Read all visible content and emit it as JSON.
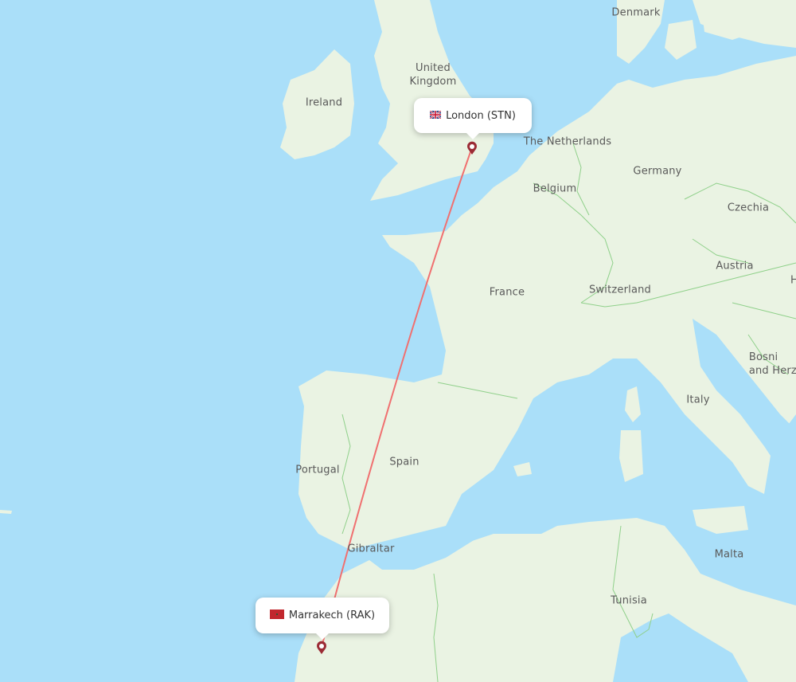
{
  "map": {
    "water_color": "#aadff9",
    "land_color": "#eaf3e3",
    "border_color": "#8fd08a",
    "route_color": "#f07070",
    "marker_color": "#9b2b35"
  },
  "origin": {
    "name": "London (STN)",
    "flag": "uk-flag-icon"
  },
  "destination": {
    "name": "Marrakech (RAK)",
    "flag": "morocco-flag-icon"
  },
  "country_labels": [
    {
      "id": "denmark",
      "text": "Denmark"
    },
    {
      "id": "united-kingdom",
      "text": "United\nKingdom"
    },
    {
      "id": "ireland",
      "text": "Ireland"
    },
    {
      "id": "netherlands",
      "text": "The Netherlands"
    },
    {
      "id": "germany",
      "text": "Germany"
    },
    {
      "id": "belgium",
      "text": "Belgium"
    },
    {
      "id": "czechia",
      "text": "Czechia"
    },
    {
      "id": "austria",
      "text": "Austria"
    },
    {
      "id": "hungary",
      "text": "H"
    },
    {
      "id": "switzerland",
      "text": "Switzerland"
    },
    {
      "id": "france",
      "text": "France"
    },
    {
      "id": "bosnia",
      "text": "Bosni\nand Herze"
    },
    {
      "id": "italy",
      "text": "Italy"
    },
    {
      "id": "spain",
      "text": "Spain"
    },
    {
      "id": "portugal",
      "text": "Portugal"
    },
    {
      "id": "gibraltar",
      "text": "Gibraltar"
    },
    {
      "id": "malta",
      "text": "Malta"
    },
    {
      "id": "tunisia",
      "text": "Tunisia"
    }
  ]
}
